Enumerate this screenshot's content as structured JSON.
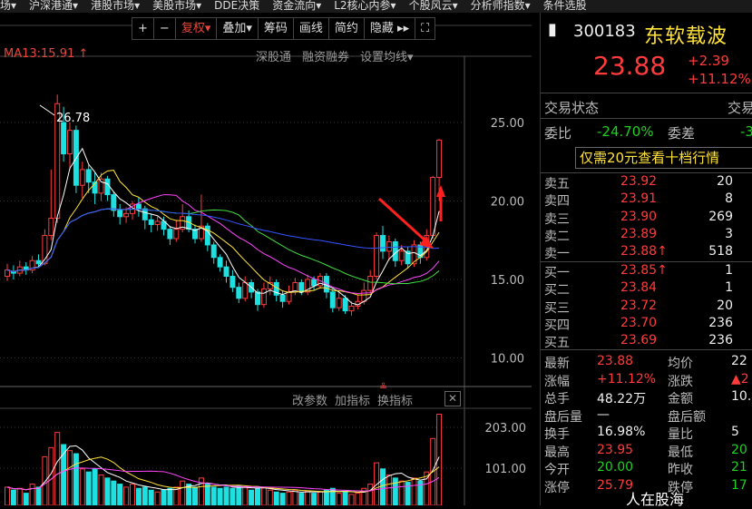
{
  "topmenu": [
    "场▾",
    "沪深港通▾",
    "港股市场▾",
    "美股市场▾",
    "DDE决策",
    "资金流向▾",
    "L2核心内参▾",
    "个股风云▾",
    "分析师指数▾",
    "条件选股"
  ],
  "toolbar": {
    "plus": "+",
    "minus": "−",
    "fuquan": "复权▾",
    "overlay": "叠加▾",
    "chips": "筹码",
    "draw": "画线",
    "simple": "简约",
    "hide": "隐藏 ▸▸",
    "full": "⛶"
  },
  "ma_label": "MA13:15.91 ↑",
  "links": [
    "深股通",
    "融资融券",
    "设置均线▾"
  ],
  "high_label": "26.78",
  "price_axis": [
    "25.00",
    "20.00",
    "15.00",
    "10.00"
  ],
  "vol_tools": [
    "改参数",
    "加指标",
    "换指标"
  ],
  "close_icon": "✕",
  "vol_axis": [
    "203.00",
    "101.00"
  ],
  "stock": {
    "code": "300183",
    "name": "东软载波",
    "price": "23.88",
    "change": "+2.39",
    "pct": "+11.12%"
  },
  "status": {
    "label": "交易状态",
    "label2": "交易"
  },
  "weibi": {
    "label": "委比",
    "value": "-24.70%",
    "label2": "委差",
    "value2": "-3"
  },
  "ad": "仅需20元查看十档行情",
  "asks": [
    {
      "label": "卖五",
      "price": "23.92",
      "vol": "20"
    },
    {
      "label": "卖四",
      "price": "23.91",
      "vol": "8"
    },
    {
      "label": "卖三",
      "price": "23.90",
      "vol": "269"
    },
    {
      "label": "卖二",
      "price": "23.89",
      "vol": "3"
    },
    {
      "label": "卖一",
      "price": "23.88↑",
      "vol": "518"
    }
  ],
  "bids": [
    {
      "label": "买一",
      "price": "23.85↑",
      "vol": "1"
    },
    {
      "label": "买二",
      "price": "23.84",
      "vol": "1"
    },
    {
      "label": "买三",
      "price": "23.72",
      "vol": "20"
    },
    {
      "label": "买四",
      "price": "23.70",
      "vol": "236"
    },
    {
      "label": "买五",
      "price": "23.69",
      "vol": "236"
    }
  ],
  "stats": [
    {
      "l": "最新",
      "v": "23.88",
      "l2": "均价",
      "v2": "22"
    },
    {
      "l": "涨幅",
      "v": "+11.12%",
      "l2": "涨跌",
      "v2": "▲2"
    },
    {
      "l": "总手",
      "v": "48.22万",
      "l2": "金额",
      "v2": "10.7"
    },
    {
      "l": "盘后量",
      "v": "—",
      "l2": "盘后额",
      "v2": ""
    },
    {
      "l": "换手",
      "v": "16.98%",
      "l2": "量比",
      "v2": "5"
    },
    {
      "l": "最高",
      "v": "23.95",
      "l2": "最低",
      "v2": "20"
    },
    {
      "l": "今开",
      "v": "20.00",
      "l2": "昨收",
      "v2": "21"
    },
    {
      "l": "涨停",
      "v": "25.79",
      "l2": "跌停",
      "v2": "17"
    }
  ],
  "watermark": "人在股海"
}
